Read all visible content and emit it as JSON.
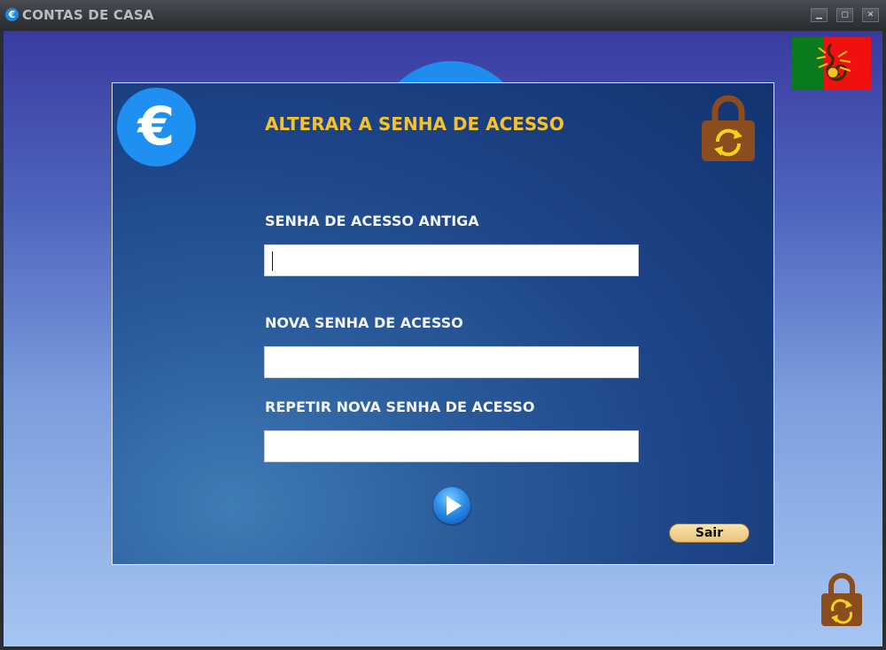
{
  "window": {
    "title": "CONTAS DE CASA",
    "icon": "euro-icon",
    "controls": {
      "minimize": "minimize-icon",
      "maximize": "maximize-icon",
      "close": "close-icon"
    }
  },
  "dialog": {
    "title": "ALTERAR A SENHA DE ACESSO",
    "fields": [
      {
        "label": "SENHA DE ACESSO ANTIGA",
        "value": ""
      },
      {
        "label": "NOVA SENHA DE ACESSO",
        "value": ""
      },
      {
        "label": "REPETIR NOVA SENHA DE ACESSO",
        "value": ""
      }
    ],
    "confirm_icon": "play-icon",
    "exit_label": "Sair",
    "logo_symbol": "€"
  },
  "icons": {
    "lock": "lock-refresh-icon",
    "flag": "portugal-flag-icon"
  },
  "colors": {
    "heading": "#f6c22c",
    "accent": "#1e90f2",
    "lock": "#8b4d1e"
  }
}
